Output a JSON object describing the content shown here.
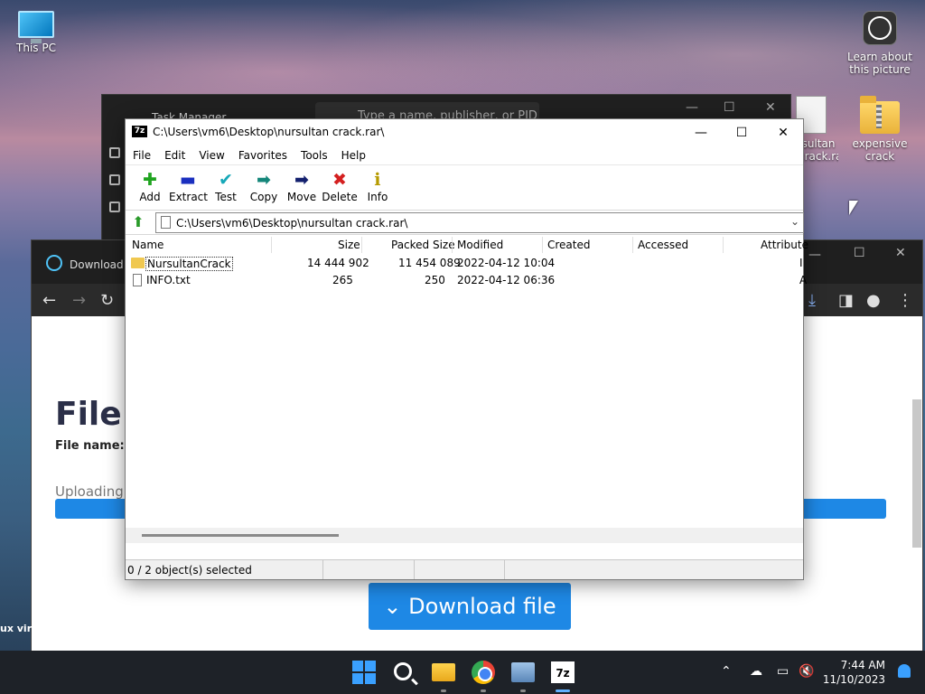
{
  "desktop": {
    "icons": [
      {
        "label": "This PC"
      },
      {
        "label": "Learn about this picture"
      },
      {
        "label": "sultan crack.rar"
      },
      {
        "label": "expensive crack"
      }
    ],
    "side_text": "ux viru"
  },
  "task_manager": {
    "title": "Task Manager",
    "search_placeholder": "Type a name, publisher, or PID"
  },
  "browser": {
    "tab_title": "Download f",
    "heading": "File",
    "file_name_label": "File name:",
    "uploading_label": "Uploading:",
    "download_button": "⌄ Download file",
    "accent_color": "#1e88e5"
  },
  "sevenzip": {
    "title": "C:\\Users\\vm6\\Desktop\\nursultan crack.rar\\",
    "menu": [
      "File",
      "Edit",
      "View",
      "Favorites",
      "Tools",
      "Help"
    ],
    "toolbar": [
      {
        "label": "Add",
        "icon": "plus-icon"
      },
      {
        "label": "Extract",
        "icon": "minus-icon"
      },
      {
        "label": "Test",
        "icon": "check-icon"
      },
      {
        "label": "Copy",
        "icon": "copy-arrow-icon"
      },
      {
        "label": "Move",
        "icon": "move-arrow-icon"
      },
      {
        "label": "Delete",
        "icon": "delete-x-icon"
      },
      {
        "label": "Info",
        "icon": "info-icon"
      }
    ],
    "address": "C:\\Users\\vm6\\Desktop\\nursultan crack.rar\\",
    "columns": [
      "Name",
      "Size",
      "Packed Size",
      "Modified",
      "Created",
      "Accessed",
      "Attribute"
    ],
    "rows": [
      {
        "name": "NursultanCrack",
        "size": "14 444 902",
        "packed": "11 454 089",
        "modified": "2022-04-12 10:04",
        "attr": "I",
        "type": "folder"
      },
      {
        "name": "INFO.txt",
        "size": "265",
        "packed": "250",
        "modified": "2022-04-12 06:36",
        "attr": "A",
        "type": "file"
      }
    ],
    "status": "0 / 2 object(s) selected"
  },
  "taskbar": {
    "time": "7:44 AM",
    "date": "11/10/2023"
  }
}
